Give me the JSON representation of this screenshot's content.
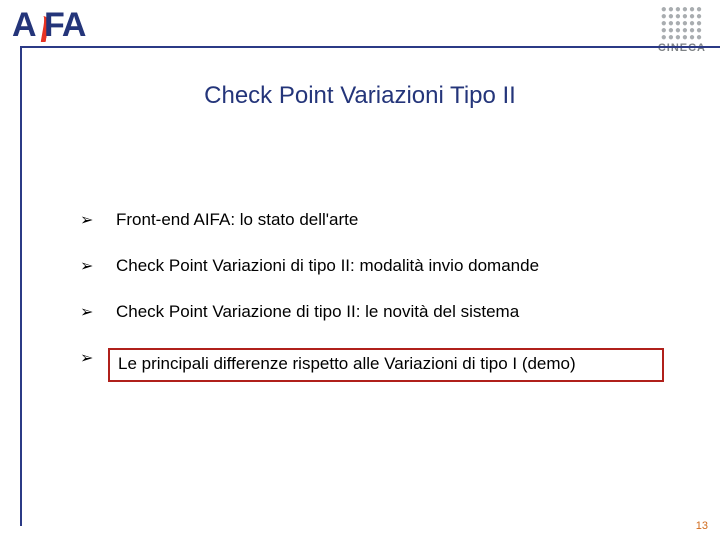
{
  "logos": {
    "aifa": {
      "name": "AIFA"
    },
    "cineca": {
      "label": "CINECA"
    }
  },
  "title": "Check Point Variazioni Tipo II",
  "bullet_marker": "➢",
  "bullets": [
    {
      "text": "Front-end AIFA: lo stato dell'arte",
      "highlight": false
    },
    {
      "text": "Check Point Variazioni di tipo II: modalità invio domande",
      "highlight": false
    },
    {
      "text": "Check Point Variazione di tipo II: le novità del sistema",
      "highlight": false
    },
    {
      "text": "Le principali differenze rispetto alle Variazioni di tipo I (demo)",
      "highlight": true
    }
  ],
  "page_number": "13"
}
